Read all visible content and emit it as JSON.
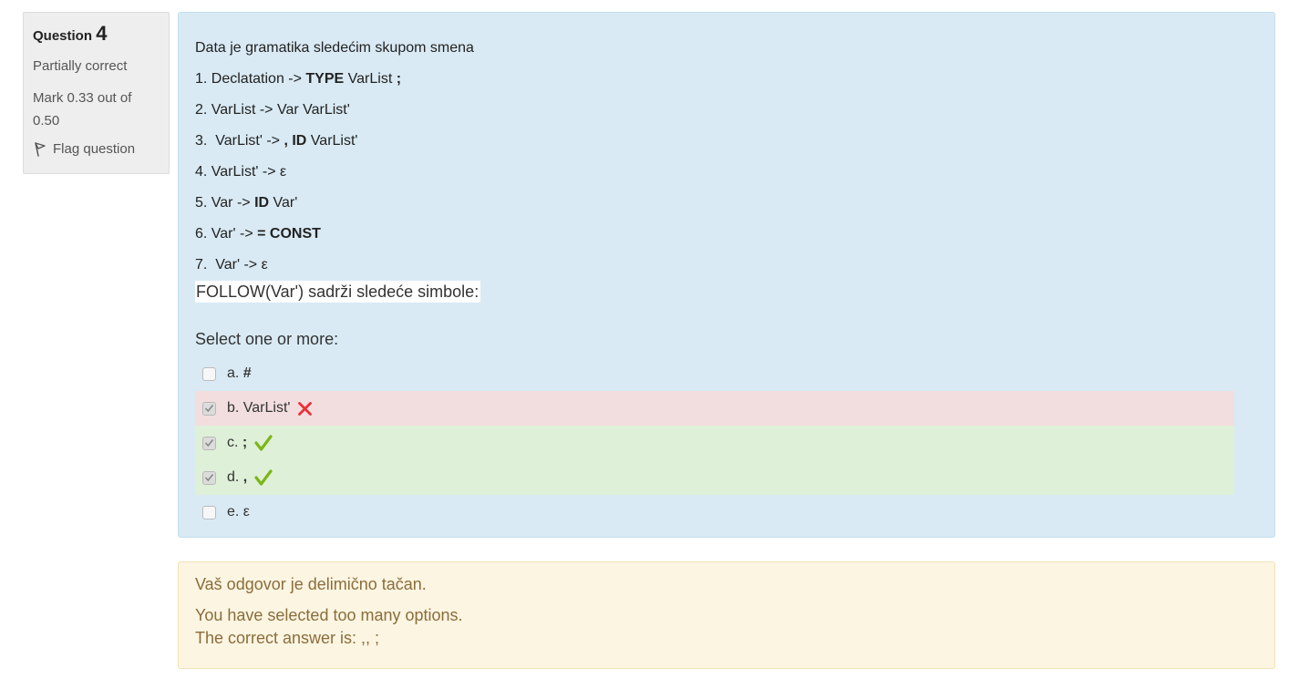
{
  "question": {
    "label": "Question",
    "number": "4",
    "state": "Partially correct",
    "grade": "Mark 0.33 out of 0.50",
    "flag_label": "Flag question"
  },
  "qtext": {
    "intro": "Data je gramatika sledećim skupom smena",
    "rules": [
      [
        "1. Declatation -> ",
        "TYPE",
        " VarList ",
        ";"
      ],
      [
        "2. VarList -> Var VarList'"
      ],
      [
        "3.  VarList' -> ",
        ", ID",
        " VarList'"
      ],
      [
        "4. VarList' -> ε"
      ],
      [
        "5. Var -> ",
        "ID",
        " Var'"
      ],
      [
        "6. Var' -> ",
        "= CONST"
      ],
      [
        "7.  Var' -> ε"
      ]
    ],
    "follow": "FOLLOW(Var') sadrži sledeće simbole:"
  },
  "prompt": "Select one or more:",
  "answers": [
    {
      "letter": "a. ",
      "text": "#",
      "checked": false,
      "status": "none"
    },
    {
      "letter": "b. ",
      "text": "VarList'",
      "checked": true,
      "status": "incorrect"
    },
    {
      "letter": "c. ",
      "text": ";",
      "checked": true,
      "status": "correct"
    },
    {
      "letter": "d. ",
      "text": ",",
      "checked": true,
      "status": "correct"
    },
    {
      "letter": "e. ",
      "text": "ε",
      "checked": false,
      "status": "none"
    }
  ],
  "feedback": {
    "specific": "Vaš odgovor je delimično tačan.",
    "line1": "You have selected too many options.",
    "line2": "The correct answer is: ,, ;"
  },
  "colors": {
    "incorrect_bg": "#f2dede",
    "correct_bg": "#dff0d8",
    "content_bg": "#d9eaf4",
    "feedback_bg": "#fcf5e2",
    "cross": "#e8313a",
    "tick": "#7cb518"
  }
}
